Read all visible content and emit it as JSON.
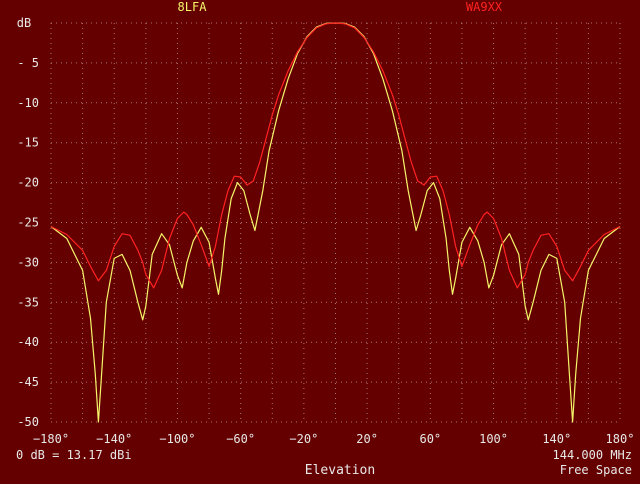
{
  "colors": {
    "background": "#650000",
    "grid": "#b88a8a",
    "text": "#e8e8e8",
    "series_a": "#f5f56a",
    "series_b": "#ff2222"
  },
  "chart_data": {
    "type": "line",
    "grid": true,
    "y_axis_label_top": "dB",
    "xlim": [
      -180,
      180
    ],
    "ylim": [
      -50,
      0
    ],
    "x_ticks": [
      -180,
      -140,
      -100,
      -60,
      -20,
      20,
      60,
      100,
      140,
      180
    ],
    "x_tick_labels": [
      "−180°",
      "−140°",
      "−100°",
      "−60°",
      "−20°",
      "20°",
      "60°",
      "100°",
      "140°",
      "180°"
    ],
    "y_ticks": [
      -5,
      -10,
      -15,
      -20,
      -25,
      -30,
      -35,
      -40,
      -45,
      -50
    ],
    "y_tick_labels": [
      "- 5",
      "-10",
      "-15",
      "-20",
      "-25",
      "-30",
      "-35",
      "-40",
      "-45",
      "-50"
    ],
    "bottom_left_text": "0 dB = 13.17 dBi",
    "xlabel": "Elevation",
    "frequency": "144.000 MHz",
    "environment": "Free Space",
    "series": [
      {
        "name": "8LFA",
        "color": "#f5f56a",
        "x": [
          -180,
          -170,
          -160,
          -155,
          -152,
          -150,
          -148,
          -145,
          -140,
          -135,
          -130,
          -125,
          -122,
          -120,
          -116,
          -110,
          -105,
          -100,
          -97,
          -94,
          -90,
          -85,
          -80,
          -76,
          -74,
          -72,
          -70,
          -66,
          -62,
          -58,
          -54,
          -51,
          -49,
          -46,
          -42,
          -36,
          -30,
          -24,
          -18,
          -12,
          -6,
          0,
          6,
          12,
          18,
          24,
          30,
          36,
          42,
          46,
          49,
          51,
          54,
          58,
          62,
          66,
          70,
          72,
          74,
          76,
          80,
          85,
          90,
          94,
          97,
          100,
          105,
          110,
          116,
          120,
          122,
          125,
          130,
          135,
          140,
          145,
          148,
          150,
          152,
          155,
          160,
          170,
          180
        ],
        "y": [
          -25.5,
          -27,
          -31,
          -37,
          -44,
          -50,
          -44,
          -35,
          -29.5,
          -29,
          -31,
          -35,
          -37.2,
          -35.5,
          -29,
          -26.4,
          -27.8,
          -31.6,
          -33.2,
          -30,
          -27.3,
          -25.6,
          -27.5,
          -32,
          -34,
          -31,
          -27,
          -22,
          -20,
          -21,
          -24,
          -26,
          -24,
          -21,
          -16,
          -11,
          -7,
          -3.8,
          -1.7,
          -0.5,
          -0.05,
          0,
          -0.05,
          -0.5,
          -1.7,
          -3.8,
          -7,
          -11,
          -16,
          -21,
          -24,
          -26,
          -24,
          -21,
          -20,
          -22,
          -27,
          -31,
          -34,
          -32,
          -27.5,
          -25.6,
          -27.3,
          -30,
          -33.2,
          -31.6,
          -27.8,
          -26.4,
          -29,
          -35.5,
          -37.2,
          -35,
          -31,
          -29,
          -29.5,
          -35,
          -44,
          -50,
          -44,
          -37,
          -31,
          -27,
          -25.5
        ]
      },
      {
        "name": "WA9XX",
        "color": "#ff2222",
        "x": [
          -180,
          -170,
          -160,
          -155,
          -150,
          -145,
          -140,
          -135,
          -130,
          -125,
          -122,
          -120,
          -115,
          -110,
          -105,
          -100,
          -96,
          -94,
          -90,
          -85,
          -80,
          -76,
          -72,
          -68,
          -64,
          -60,
          -56,
          -52,
          -48,
          -44,
          -40,
          -36,
          -30,
          -24,
          -18,
          -12,
          -6,
          0,
          6,
          12,
          18,
          24,
          30,
          36,
          40,
          44,
          48,
          52,
          56,
          60,
          64,
          68,
          72,
          76,
          80,
          85,
          90,
          94,
          96,
          100,
          105,
          110,
          115,
          120,
          122,
          125,
          130,
          135,
          140,
          145,
          150,
          155,
          160,
          170,
          180
        ],
        "y": [
          -25.5,
          -26.5,
          -28.5,
          -30.5,
          -32.3,
          -31,
          -28,
          -26.4,
          -26.6,
          -28.5,
          -30,
          -31.5,
          -33.2,
          -31,
          -27,
          -24.5,
          -23.7,
          -24,
          -25.3,
          -27.8,
          -30.5,
          -28,
          -24,
          -21,
          -19.2,
          -19.3,
          -20.3,
          -19.8,
          -17.5,
          -14.5,
          -11.5,
          -9,
          -6,
          -3.6,
          -1.8,
          -0.6,
          -0.1,
          0,
          -0.1,
          -0.6,
          -1.8,
          -3.6,
          -6,
          -9,
          -11.5,
          -14.5,
          -17.5,
          -19.8,
          -20.3,
          -19.3,
          -19.2,
          -21,
          -24,
          -28,
          -30.5,
          -27.8,
          -25.3,
          -24,
          -23.7,
          -24.5,
          -27,
          -31,
          -33.2,
          -31.5,
          -30,
          -28.5,
          -26.6,
          -26.4,
          -28,
          -31,
          -32.3,
          -30.5,
          -28.5,
          -26.5,
          -25.5
        ]
      }
    ]
  }
}
